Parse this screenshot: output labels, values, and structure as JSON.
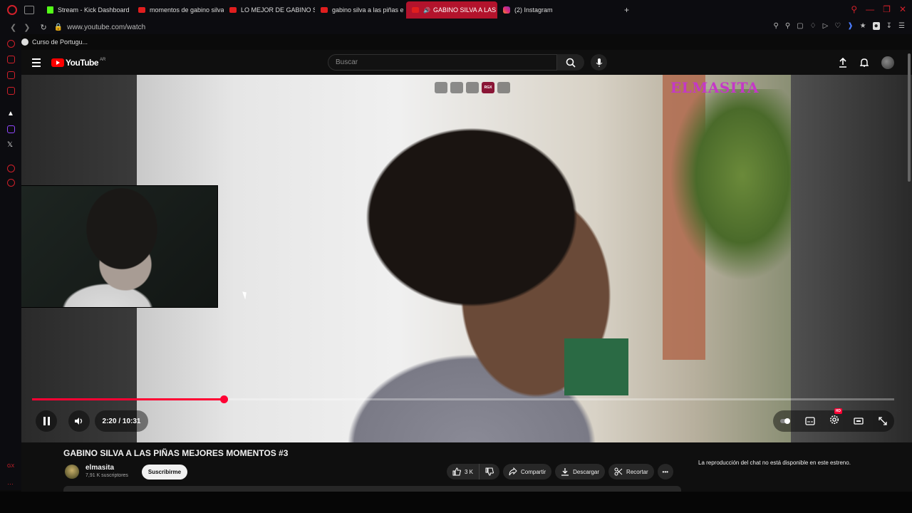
{
  "browser": {
    "tabs": [
      {
        "label": "Stream - Kick Dashboard",
        "favicon": "kick-icon",
        "active": false
      },
      {
        "label": "momentos de gabino silva",
        "favicon": "youtube-icon",
        "active": false
      },
      {
        "label": "LO MEJOR DE GABINO SI",
        "favicon": "youtube-icon",
        "active": false
      },
      {
        "label": "gabino silva a las piñas e",
        "favicon": "youtube-icon",
        "active": false
      },
      {
        "label": "GABINO SILVA A LAS",
        "favicon": "youtube-icon",
        "active": true
      },
      {
        "label": "(2) Instagram",
        "favicon": "instagram-icon",
        "active": false
      }
    ],
    "new_tab": "+",
    "url": "www.youtube.com/watch",
    "bookmark": "Curso de Portugu...",
    "accent_color": "#d0202a"
  },
  "youtube": {
    "logo_text": "YouTube",
    "logo_region": "AR",
    "search_placeholder": "Buscar",
    "player": {
      "watermark": "ELMASITA",
      "time": "2:20 / 10:31",
      "progress_fraction": 0.2227,
      "hd_badge": "HD",
      "overlay_tool": "RGX"
    },
    "video": {
      "title": "GABINO SILVA A LAS PIÑAS MEJORES MOMENTOS #3",
      "channel": "elmasita",
      "subscribers": "7,91 K suscriptores",
      "subscribe_label": "Suscribirme",
      "likes": "3 K",
      "share_label": "Compartir",
      "download_label": "Descargar",
      "clip_label": "Recortar",
      "more_label": "•••"
    },
    "chat_unavailable": "La reproducción del chat no está disponible en este estreno."
  }
}
